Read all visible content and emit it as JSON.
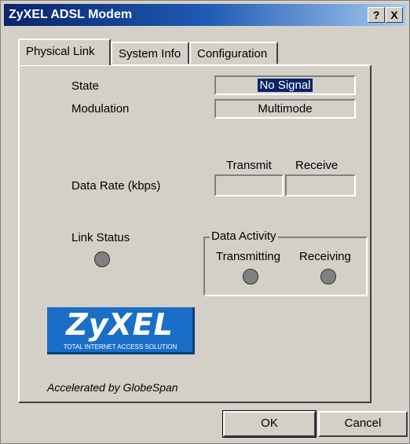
{
  "window": {
    "title": "ZyXEL ADSL Modem"
  },
  "titlebar_buttons": {
    "help": "?",
    "close": "X"
  },
  "tabs": [
    {
      "label": "Physical Link",
      "active": true
    },
    {
      "label": "System Info",
      "active": false
    },
    {
      "label": "Configuration",
      "active": false
    }
  ],
  "physical_link": {
    "state_label": "State",
    "state_value": "No Signal",
    "modulation_label": "Modulation",
    "modulation_value": "Multimode",
    "transmit_header": "Transmit",
    "receive_header": "Receive",
    "data_rate_label": "Data Rate (kbps)",
    "transmit_value": "",
    "receive_value": "",
    "link_status_label": "Link Status",
    "data_activity_label": "Data Activity",
    "transmitting_label": "Transmitting",
    "receiving_label": "Receiving"
  },
  "logo": {
    "name": "ZyXEL",
    "tagline": "TOTAL INTERNET ACCESS SOLUTION",
    "color": "#1a6ec8"
  },
  "footer_text": "Accelerated by GlobeSpan",
  "buttons": {
    "ok": "OK",
    "cancel": "Cancel"
  },
  "colors": {
    "title_bar": "#0a246a",
    "led_off": "#808080",
    "face": "#d4d0c8"
  }
}
